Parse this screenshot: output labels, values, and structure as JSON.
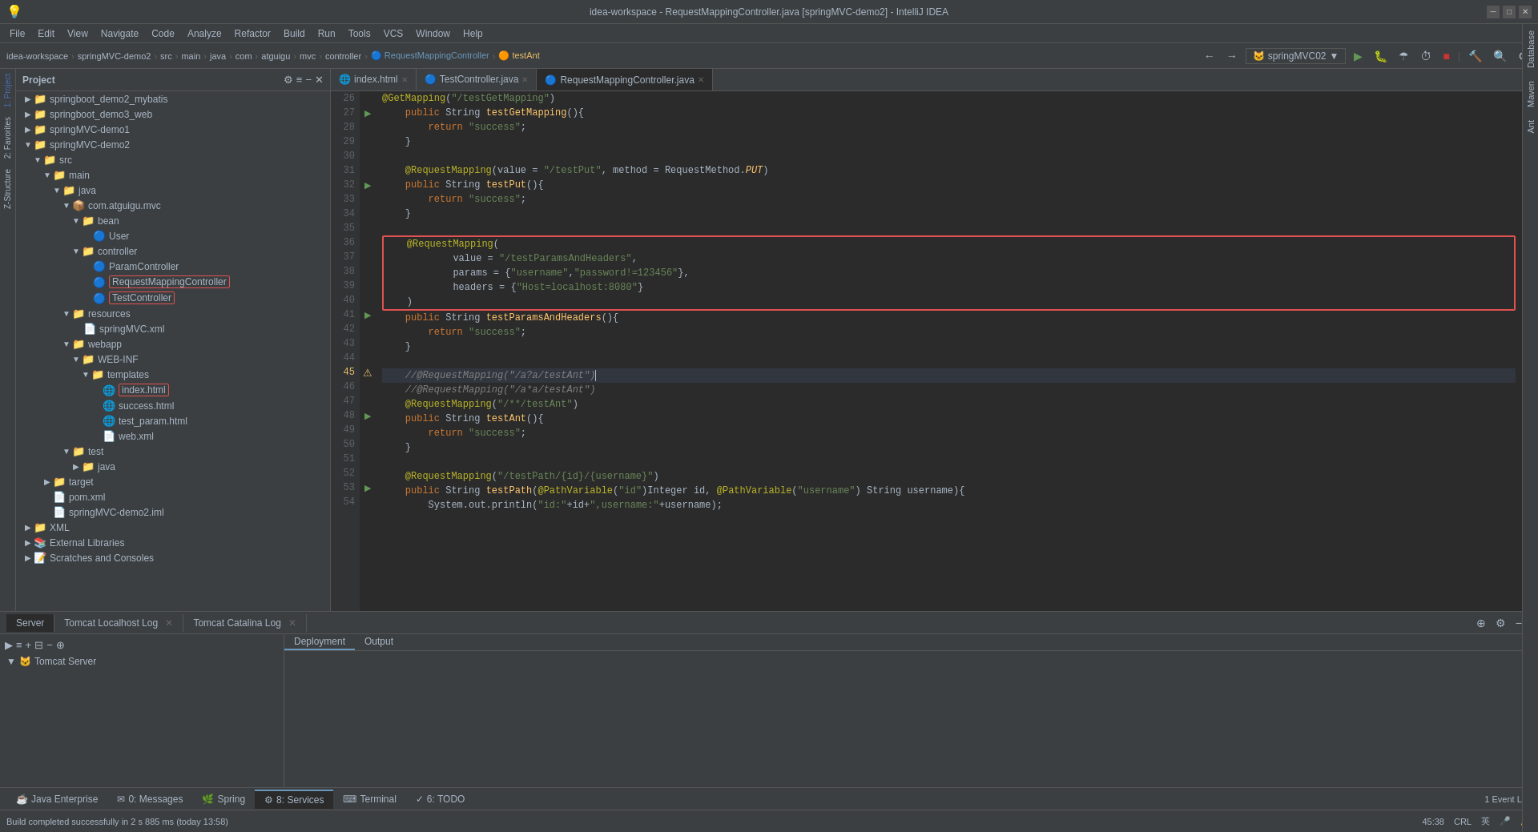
{
  "titleBar": {
    "title": "idea-workspace - RequestMappingController.java [springMVC-demo2] - IntelliJ IDEA",
    "controls": [
      "minimize",
      "maximize",
      "close"
    ]
  },
  "menuBar": {
    "items": [
      "File",
      "Edit",
      "View",
      "Navigate",
      "Code",
      "Analyze",
      "Refactor",
      "Build",
      "Run",
      "Tools",
      "VCS",
      "Window",
      "Help"
    ]
  },
  "breadcrumb": {
    "items": [
      "idea-workspace",
      "springMVC-demo2",
      "src",
      "main",
      "java",
      "com",
      "atguigu",
      "mvc",
      "controller",
      "RequestMappingController",
      "testAnt"
    ]
  },
  "runConfig": {
    "label": "springMVC02",
    "icon": "▶"
  },
  "sidebar": {
    "title": "Project",
    "items": [
      {
        "label": "springboot_demo2_mybatis",
        "type": "folder",
        "indent": 1,
        "expanded": false
      },
      {
        "label": "springboot_demo3_web",
        "type": "folder",
        "indent": 1,
        "expanded": false
      },
      {
        "label": "springMVC-demo1",
        "type": "folder",
        "indent": 1,
        "expanded": false
      },
      {
        "label": "springMVC-demo2",
        "type": "folder",
        "indent": 1,
        "expanded": true
      },
      {
        "label": "src",
        "type": "folder",
        "indent": 2,
        "expanded": true
      },
      {
        "label": "main",
        "type": "folder",
        "indent": 3,
        "expanded": true
      },
      {
        "label": "java",
        "type": "folder",
        "indent": 4,
        "expanded": true
      },
      {
        "label": "com.atguigu.mvc",
        "type": "package",
        "indent": 5,
        "expanded": true
      },
      {
        "label": "bean",
        "type": "folder",
        "indent": 6,
        "expanded": true
      },
      {
        "label": "User",
        "type": "java",
        "indent": 7
      },
      {
        "label": "controller",
        "type": "folder",
        "indent": 6,
        "expanded": true
      },
      {
        "label": "ParamController",
        "type": "java",
        "indent": 7
      },
      {
        "label": "RequestMappingController",
        "type": "java",
        "indent": 7,
        "highlighted": true
      },
      {
        "label": "TestController",
        "type": "java",
        "indent": 7,
        "highlighted": true
      },
      {
        "label": "resources",
        "type": "folder",
        "indent": 5,
        "expanded": true
      },
      {
        "label": "springMVC.xml",
        "type": "xml",
        "indent": 6
      },
      {
        "label": "webapp",
        "type": "folder",
        "indent": 5,
        "expanded": true
      },
      {
        "label": "WEB-INF",
        "type": "folder",
        "indent": 6,
        "expanded": true
      },
      {
        "label": "templates",
        "type": "folder",
        "indent": 7,
        "expanded": true
      },
      {
        "label": "index.html",
        "type": "html",
        "indent": 8,
        "highlighted": true
      },
      {
        "label": "success.html",
        "type": "html",
        "indent": 8
      },
      {
        "label": "test_param.html",
        "type": "html",
        "indent": 8
      },
      {
        "label": "web.xml",
        "type": "xml",
        "indent": 8
      },
      {
        "label": "test",
        "type": "folder",
        "indent": 5,
        "expanded": true
      },
      {
        "label": "java",
        "type": "folder",
        "indent": 6,
        "expanded": false
      },
      {
        "label": "target",
        "type": "folder",
        "indent": 4,
        "expanded": false
      },
      {
        "label": "pom.xml",
        "type": "xml",
        "indent": 4
      },
      {
        "label": "springMVC-demo2.iml",
        "type": "iml",
        "indent": 4
      },
      {
        "label": "XML",
        "type": "folder",
        "indent": 1,
        "expanded": false
      },
      {
        "label": "External Libraries",
        "type": "folder",
        "indent": 1,
        "expanded": false
      },
      {
        "label": "Scratches and Consoles",
        "type": "folder",
        "indent": 1,
        "expanded": false
      }
    ]
  },
  "tabs": [
    {
      "label": "index.html",
      "type": "html",
      "active": false,
      "closable": true
    },
    {
      "label": "TestController.java",
      "type": "java",
      "active": false,
      "closable": true
    },
    {
      "label": "RequestMappingController.java",
      "type": "java",
      "active": true,
      "closable": true
    }
  ],
  "codeLines": [
    {
      "num": 26,
      "gutter": "",
      "code": "    @GetMapping(\"/testGetMapping\")",
      "ann": true
    },
    {
      "num": 27,
      "gutter": "run",
      "code": "    public String testGetMapping(){",
      "fn": true
    },
    {
      "num": 28,
      "gutter": "",
      "code": "        return \"success\";"
    },
    {
      "num": 29,
      "gutter": "",
      "code": "    }"
    },
    {
      "num": 30,
      "gutter": "",
      "code": ""
    },
    {
      "num": 31,
      "gutter": "",
      "code": "    @RequestMapping(value = \"/testPut\", method = RequestMethod.PUT)",
      "ann": true
    },
    {
      "num": 32,
      "gutter": "run",
      "code": "    public String testPut(){",
      "fn": true
    },
    {
      "num": 33,
      "gutter": "",
      "code": "        return \"success\";"
    },
    {
      "num": 34,
      "gutter": "",
      "code": "    }"
    },
    {
      "num": 35,
      "gutter": "",
      "code": ""
    },
    {
      "num": 36,
      "gutter": "",
      "code": "    @RequestMapping(",
      "boxStart": true
    },
    {
      "num": 37,
      "gutter": "",
      "code": "            value = \"/testParamsAndHeaders\",",
      "inBox": true
    },
    {
      "num": 38,
      "gutter": "",
      "code": "            params = {\"username\",\"password!=123456\"},",
      "inBox": true
    },
    {
      "num": 39,
      "gutter": "",
      "code": "            headers = {\"Host=localhost:8080\"}",
      "inBox": true
    },
    {
      "num": 40,
      "gutter": "",
      "code": "    )",
      "boxEnd": true
    },
    {
      "num": 41,
      "gutter": "run",
      "code": "    public String testParamsAndHeaders(){",
      "fn": true
    },
    {
      "num": 42,
      "gutter": "",
      "code": "        return \"success\";"
    },
    {
      "num": 43,
      "gutter": "",
      "code": "    }"
    },
    {
      "num": 44,
      "gutter": "",
      "code": ""
    },
    {
      "num": 45,
      "gutter": "warn",
      "code": "    //@RequestMapping(\"/a?a/testAnt\")▌",
      "comment": true,
      "selected": true
    },
    {
      "num": 46,
      "gutter": "",
      "code": "    //@RequestMapping(\"/a*a/testAnt\")",
      "comment": true
    },
    {
      "num": 47,
      "gutter": "",
      "code": "    @RequestMapping(\"/**/testAnt\")",
      "ann": true
    },
    {
      "num": 48,
      "gutter": "run",
      "code": "    public String testAnt(){",
      "fn": true
    },
    {
      "num": 49,
      "gutter": "",
      "code": "        return \"success\";"
    },
    {
      "num": 50,
      "gutter": "",
      "code": "    }"
    },
    {
      "num": 51,
      "gutter": "",
      "code": ""
    },
    {
      "num": 52,
      "gutter": "",
      "code": "    @RequestMapping(\"/testPath/{id}/{username}\")",
      "ann": true
    },
    {
      "num": 53,
      "gutter": "run",
      "code": "    public String testPath(@PathVariable(\"id\")Integer id, @PathVariable(\"username\") String username){",
      "fn": true
    },
    {
      "num": 54,
      "gutter": "",
      "code": "        System.out.println(\"id:\"+id+\",username:\"+username);"
    }
  ],
  "bottomPanel": {
    "title": "Services",
    "serverTabs": [
      "Server",
      "Tomcat Localhost Log",
      "Tomcat Catalina Log"
    ],
    "deployTabs": [
      "Deployment",
      "Output"
    ],
    "serverItem": "Tomcat Server"
  },
  "bottomNavTabs": [
    {
      "label": "Java Enterprise",
      "icon": "☕",
      "active": false
    },
    {
      "label": "0: Messages",
      "icon": "✉",
      "active": false
    },
    {
      "label": "Spring",
      "icon": "🌿",
      "active": false
    },
    {
      "label": "8: Services",
      "icon": "⚙",
      "active": true
    },
    {
      "label": "Terminal",
      "icon": "⌨",
      "active": false
    },
    {
      "label": "6: TODO",
      "icon": "✓",
      "active": false
    }
  ],
  "statusBar": {
    "message": "Build completed successfully in 2 s 885 ms (today 13:58)",
    "position": "45:38",
    "encoding": "CRL",
    "lang": "英"
  },
  "verticalTabs": {
    "right": [
      "Database",
      "Maven",
      "Ant"
    ]
  },
  "leftTabs": [
    "1: Project",
    "2: Favorites",
    "Z-Structure"
  ]
}
